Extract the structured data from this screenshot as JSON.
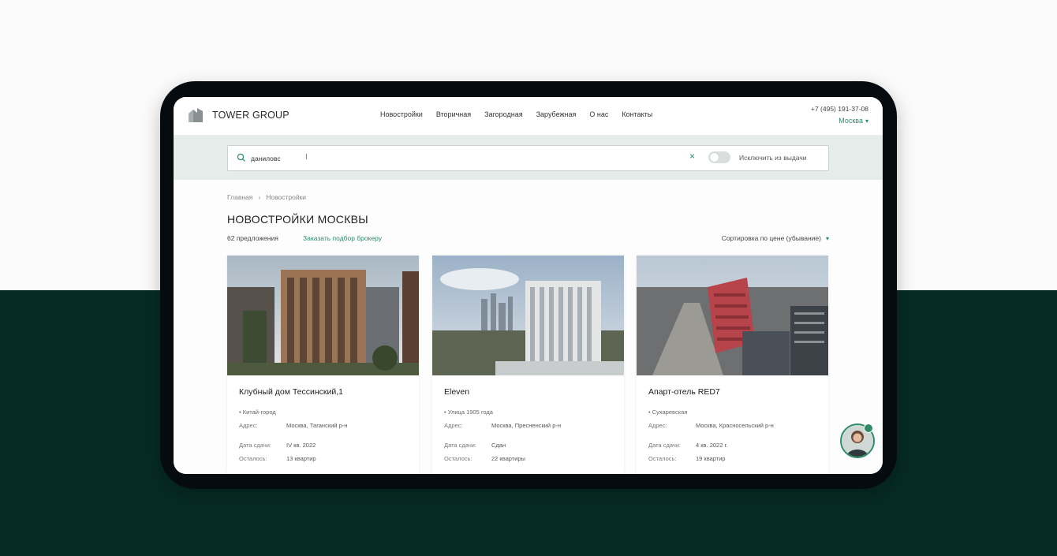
{
  "brand": {
    "name": "TOWER GROUP"
  },
  "nav": {
    "items": [
      "Новостройки",
      "Вторичная",
      "Загородная",
      "Зарубежная",
      "О нас",
      "Контакты"
    ]
  },
  "contact": {
    "phone": "+7 (495) 191-37-08",
    "city": "Москва"
  },
  "search": {
    "value": "даниловс",
    "exclude_label": "Исключить из выдачи",
    "exclude_enabled": false
  },
  "breadcrumb": [
    "Главная",
    "Новостройки"
  ],
  "page": {
    "title": "НОВОСТРОЙКИ МОСКВЫ",
    "offers_count": "62 предложения",
    "broker_link": "Заказать подбор брокеру",
    "sort_label": "Сортировка по цене (убывание)"
  },
  "labels": {
    "address": "Адрес:",
    "delivery": "Дата сдачи:",
    "remaining": "Осталось:"
  },
  "cards": [
    {
      "title": "Клубный дом Тессинский,1",
      "district": "• Китай-город",
      "address": "Москва, Таганский р-н",
      "delivery": "IV кв. 2022",
      "remaining": "13 квартир"
    },
    {
      "title": "Eleven",
      "district": "• Улица 1905 года",
      "address": "Москва, Пресненский р-н",
      "delivery": "Сдан",
      "remaining": "22 квартиры"
    },
    {
      "title": "Апарт-отель RED7",
      "district": "• Сухаревская",
      "address": "Москва, Красносельский р-н",
      "delivery": "4 кв. 2022 г.",
      "remaining": "19 квартир"
    }
  ],
  "colors": {
    "accent": "#2c8b65",
    "dark_bg": "#062b24",
    "device": "#060b10",
    "search_band": "#e6ecea"
  }
}
